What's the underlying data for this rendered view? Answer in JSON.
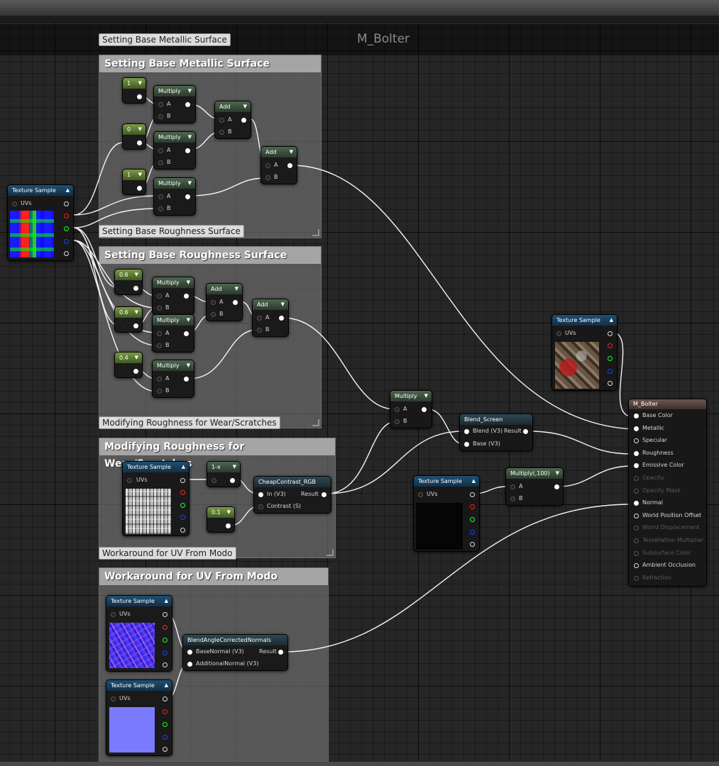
{
  "graph": {
    "title": "M_Bolter"
  },
  "comments": [
    {
      "id": "metallic",
      "title": "Setting Base Metallic Surface"
    },
    {
      "id": "roughness",
      "title": "Setting Base Roughness Surface"
    },
    {
      "id": "wear",
      "title": "Modifying Roughness for Wear/Scratches"
    },
    {
      "id": "uv",
      "title": "Workaround for UV From Modo"
    }
  ],
  "labels": {
    "texture_sample": "Texture Sample",
    "uvs": "UVs",
    "multiply": "Multiply",
    "add": "Add",
    "a": "A",
    "b": "B",
    "one_minus_x": "1-x",
    "cheap_contrast": "CheapContrast_RGB",
    "in_v3": "In (V3)",
    "contrast_s": "Contrast (S)",
    "result": "Result",
    "blend_screen": "Blend_Screen",
    "blend_v3": "Blend (V3)",
    "base_v3": "Base (V3)",
    "multiply_100": "Multiply(,100)",
    "blend_angle": "BlendAngleCorrectedNormals",
    "base_normal": "BaseNormal (V3)",
    "additional_normal": "AdditionalNormal (V3)"
  },
  "constants": {
    "m1": "1",
    "m2": "0",
    "m3": "1",
    "r1": "0.6",
    "r2": "0.6",
    "r3": "0.4",
    "wear": "0.1"
  },
  "result_node": {
    "title": "M_Bolter",
    "inputs": [
      {
        "label": "Base Color",
        "enabled": true
      },
      {
        "label": "Metallic",
        "enabled": true
      },
      {
        "label": "Specular",
        "enabled": true
      },
      {
        "label": "Roughness",
        "enabled": true
      },
      {
        "label": "Emissive Color",
        "enabled": true
      },
      {
        "label": "Opacity",
        "enabled": false
      },
      {
        "label": "Opacity Mask",
        "enabled": false
      },
      {
        "label": "Normal",
        "enabled": true
      },
      {
        "label": "World Position Offset",
        "enabled": true
      },
      {
        "label": "World Displacement",
        "enabled": false
      },
      {
        "label": "Tessellation Multiplier",
        "enabled": false
      },
      {
        "label": "Subsurface Color",
        "enabled": false
      },
      {
        "label": "Ambient Occlusion",
        "enabled": true
      },
      {
        "label": "Refraction",
        "enabled": false
      }
    ]
  },
  "colors": {
    "background": "#262626",
    "comment_header": "#a5a5a5",
    "texture_header": "#1e4f73",
    "math_header": "#4e6650",
    "constant_header": "#7c9a47",
    "result_header": "#6e5852",
    "wire": "#ffffff"
  }
}
